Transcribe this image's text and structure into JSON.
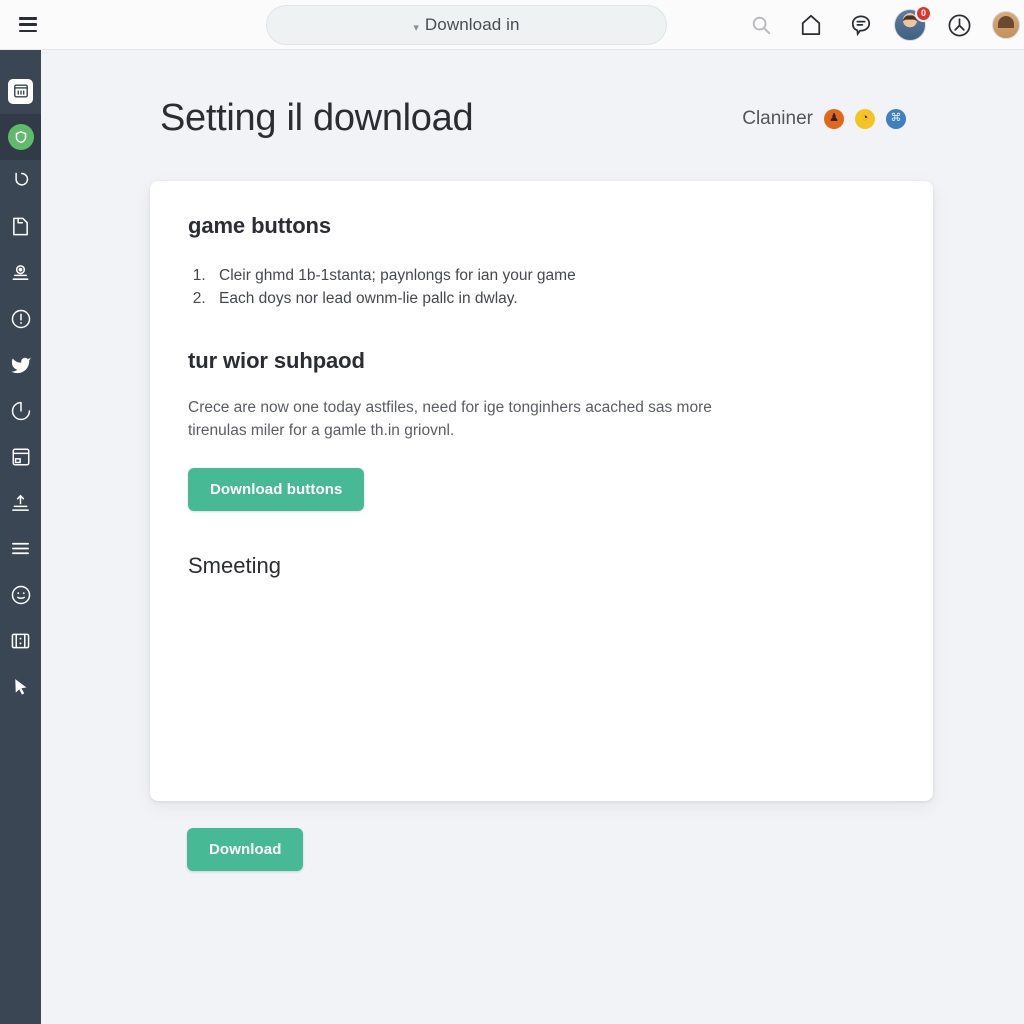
{
  "topbar": {
    "menu_icon": "list-menu-icon",
    "omnibox": {
      "prefix_icon": "download-caret-icon",
      "value": "Download in",
      "placeholder": "Download in"
    },
    "actions": [
      {
        "name": "search-icon",
        "glyph": "search"
      },
      {
        "name": "home-icon",
        "glyph": "home"
      },
      {
        "name": "chat-bubble-icon",
        "glyph": "chat"
      }
    ],
    "avatar": {
      "name": "user-avatar",
      "badge": "0"
    },
    "clock_icon": "clock-icon",
    "secondary_avatar": "secondary-avatar"
  },
  "sidebar": {
    "items": [
      {
        "label": "Dashboard",
        "icon": "bank-chart-icon",
        "style": "tile",
        "active": false
      },
      {
        "label": "Protection",
        "icon": "shield-icon",
        "style": "green",
        "active": true
      },
      {
        "label": "History",
        "icon": "undo-arrow-icon",
        "style": "plain",
        "active": false
      },
      {
        "label": "Files",
        "icon": "file-page-icon",
        "style": "plain",
        "active": false
      },
      {
        "label": "Profile",
        "icon": "user-stamp-icon",
        "style": "plain",
        "active": false
      },
      {
        "label": "Alerts",
        "icon": "info-circle-icon",
        "style": "plain",
        "active": false
      },
      {
        "label": "Social",
        "icon": "bird-icon",
        "style": "plain",
        "active": false
      },
      {
        "label": "Timer",
        "icon": "timer-pie-icon",
        "style": "plain",
        "active": false
      },
      {
        "label": "Window",
        "icon": "window-panel-icon",
        "style": "plain",
        "active": false
      },
      {
        "label": "Upload",
        "icon": "upload-stamp-icon",
        "style": "plain",
        "active": false
      },
      {
        "label": "Lists",
        "icon": "lines-list-icon",
        "style": "plain",
        "active": false
      },
      {
        "label": "Mood",
        "icon": "smiley-face-icon",
        "style": "plain",
        "active": false
      },
      {
        "label": "Media",
        "icon": "film-frame-icon",
        "style": "plain",
        "active": false
      },
      {
        "label": "Cursor",
        "icon": "cursor-arrow-icon",
        "style": "plain",
        "active": false
      }
    ]
  },
  "page": {
    "title": "Setting il download",
    "owner_label": "Claniner",
    "members": [
      {
        "name": "member-avatar-1",
        "color": "#e2671b",
        "glyph": "♟"
      },
      {
        "name": "member-avatar-2",
        "color": "#f5c423",
        "glyph": "◔"
      },
      {
        "name": "member-avatar-3",
        "color": "#3d7fc1",
        "glyph": "⌘"
      }
    ]
  },
  "card": {
    "section_one_title": "game buttons",
    "steps": [
      "Cleir ghmd 1b-1stanta; paynlongs for ian your game",
      "Each doys nor lead ownm-lie pallc in dwlay."
    ],
    "section_two_title": "tur wior suhpaod",
    "paragraph": "Crece are now one today astfiles, need for ige tonginhers acached sas more tirenulas miler for a gamle th.in griovnl.",
    "primary_button": "Download buttons",
    "section_three_title": "Smeeting"
  },
  "footer": {
    "download_button": "Download"
  },
  "colors": {
    "accent_green": "#48b995",
    "sidebar_bg": "#3b4654",
    "sidebar_active": "#313b48",
    "page_bg": "#f2f3f6",
    "card_bg": "#ffffff",
    "badge_red": "#e3312c",
    "shield_green": "#5fbb6b"
  }
}
